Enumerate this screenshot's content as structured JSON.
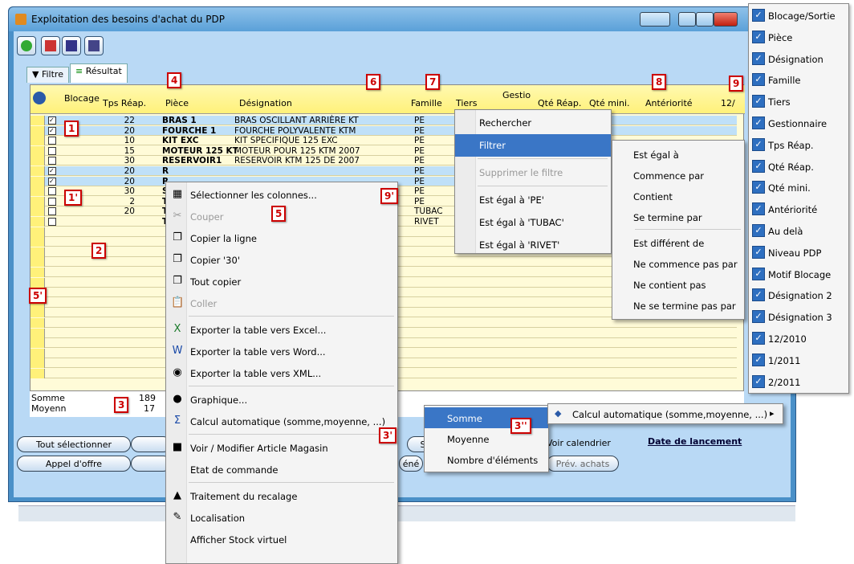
{
  "window": {
    "title": "Exploitation des besoins d'achat du PDP"
  },
  "tabs": [
    {
      "label": "Filtre"
    },
    {
      "label": "Résultat"
    }
  ],
  "grid": {
    "headers": {
      "blocage": "Blocage",
      "tps": "Tps Réap.",
      "piece": "Pièce",
      "designation": "Désignation",
      "famille": "Famille",
      "tiers": "Tiers",
      "gestio": "Gestio",
      "qte_reap": "Qté Réap.",
      "qte_mini": "Qté mini.",
      "anteriorite": "Antériorité",
      "period": "12/"
    },
    "rows": [
      {
        "tps": "22",
        "piece": "BRAS 1",
        "designation": "BRAS OSCILLANT ARRIÈRE KT",
        "famille": "PE"
      },
      {
        "tps": "20",
        "piece": "FOURCHE 1",
        "designation": "FOURCHE POLYVALENTE KTM",
        "famille": "PE"
      },
      {
        "tps": "10",
        "piece": "KIT EXC",
        "designation": "KIT SPECIFIQUE 125 EXC",
        "famille": "PE"
      },
      {
        "tps": "15",
        "piece": "MOTEUR 125 KT",
        "designation": "MOTEUR POUR 125 KTM 2007",
        "famille": "PE"
      },
      {
        "tps": "30",
        "piece": "RESERVOIR1",
        "designation": "RESERVOIR KTM 125 DE 2007",
        "famille": "PE"
      },
      {
        "tps": "20",
        "piece": "R",
        "designation": "",
        "famille": "PE"
      },
      {
        "tps": "20",
        "piece": "R",
        "designation": "",
        "famille": "PE"
      },
      {
        "tps": "30",
        "piece": "SI",
        "designation": "",
        "famille": "PE"
      },
      {
        "tps": "2",
        "piece": "TI",
        "designation": "",
        "famille": "PE"
      },
      {
        "tps": "20",
        "piece": "TI",
        "designation": "",
        "famille": "TUBAC"
      },
      {
        "tps": "",
        "piece": "T",
        "designation": "",
        "famille": "RIVET"
      }
    ]
  },
  "summary": {
    "somme_label": "Somme",
    "somme_value": "189",
    "moyenne_label": "Moyenn",
    "moyenne_value": "17"
  },
  "buttons": {
    "tout_selectionner": "Tout sélectionner",
    "appel_offre": "Appel d'offre",
    "s": "S",
    "voir_calendrier": "Voir calendrier",
    "date_lancement": "Date de lancement",
    "prev_achats": "Prév. achats",
    "gene": "éné"
  },
  "context_menu": [
    {
      "label": "Sélectionner les colonnes...",
      "icon": "columns-icon"
    },
    {
      "label": "Couper",
      "icon": "scissors-icon",
      "disabled": true
    },
    {
      "label": "Copier la ligne",
      "icon": "copy-icon"
    },
    {
      "label": "Copier '30'",
      "icon": "copy-icon"
    },
    {
      "label": "Tout copier",
      "icon": "copy-icon"
    },
    {
      "label": "Coller",
      "icon": "paste-icon",
      "disabled": true
    },
    {
      "label": "Exporter la table vers Excel...",
      "icon": "excel-icon"
    },
    {
      "label": "Exporter la table vers Word...",
      "icon": "word-icon"
    },
    {
      "label": "Exporter la table vers XML...",
      "icon": "xml-icon"
    },
    {
      "label": "Graphique...",
      "icon": "chart-icon"
    },
    {
      "label": "Calcul automatique (somme,moyenne, ...)",
      "icon": "sigma-icon"
    },
    {
      "label": "Voir / Modifier Article Magasin",
      "icon": "box-icon"
    },
    {
      "label": "Etat de commande",
      "icon": ""
    },
    {
      "label": "Traitement du recalage",
      "icon": "recalage-icon"
    },
    {
      "label": "Localisation",
      "icon": "pin-icon"
    },
    {
      "label": "Afficher Stock virtuel",
      "icon": ""
    }
  ],
  "header_menu": [
    {
      "label": "Rechercher"
    },
    {
      "label": "Filtrer"
    },
    {
      "label": "Supprimer le filtre",
      "disabled": true
    },
    {
      "label": "Est égal à 'PE'"
    },
    {
      "label": "Est égal à 'TUBAC'"
    },
    {
      "label": "Est égal à 'RIVET'"
    }
  ],
  "filter_submenu": [
    {
      "label": "Est égal à"
    },
    {
      "label": "Commence par"
    },
    {
      "label": "Contient"
    },
    {
      "label": "Se termine par"
    },
    {
      "label": "Est différent de"
    },
    {
      "label": "Ne commence pas par"
    },
    {
      "label": "Ne contient pas"
    },
    {
      "label": "Ne se termine pas par"
    }
  ],
  "calc_menu": {
    "label": "Calcul automatique (somme,moyenne, ...)"
  },
  "calc_submenu": [
    {
      "label": "Somme"
    },
    {
      "label": "Moyenne"
    },
    {
      "label": "Nombre d'éléments"
    }
  ],
  "columns": [
    {
      "label": "Blocage/Sortie"
    },
    {
      "label": "Pièce"
    },
    {
      "label": "Désignation"
    },
    {
      "label": "Famille"
    },
    {
      "label": "Tiers"
    },
    {
      "label": "Gestionnaire"
    },
    {
      "label": "Tps Réap."
    },
    {
      "label": "Qté Réap."
    },
    {
      "label": "Qté mini."
    },
    {
      "label": "Antériorité"
    },
    {
      "label": "Au delà"
    },
    {
      "label": "Niveau PDP"
    },
    {
      "label": "Motif Blocage"
    },
    {
      "label": "Désignation 2"
    },
    {
      "label": "Désignation 3"
    },
    {
      "label": "12/2010"
    },
    {
      "label": "1/2011"
    },
    {
      "label": "2/2011"
    }
  ],
  "badges": {
    "b1": "1",
    "b1p": "1'",
    "b2": "2",
    "b3": "3",
    "b3p": "3'",
    "b3pp": "3''",
    "b4": "4",
    "b5": "5",
    "b5p": "5'",
    "b6": "6",
    "b7": "7",
    "b8": "8",
    "b9": "9",
    "b9p": "9'"
  }
}
